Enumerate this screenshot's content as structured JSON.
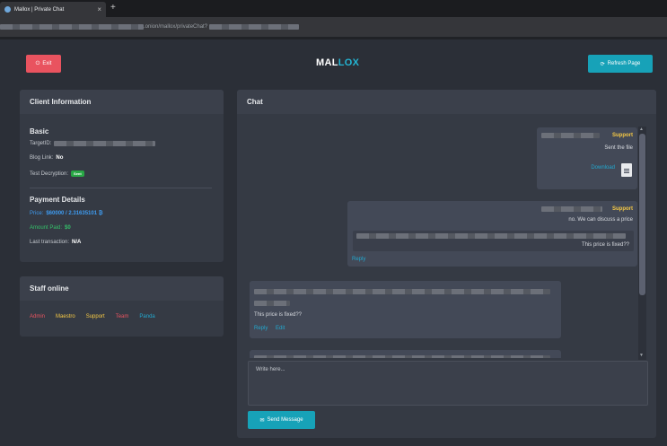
{
  "browser": {
    "tab_title": "Mallox | Private Chat",
    "tab_close": "×",
    "new_tab": "+",
    "url_visible": ".onion/mallox/privateChat?"
  },
  "header": {
    "exit_label": "Exit",
    "logo_part1": "MAL",
    "logo_part2": "LOX",
    "refresh_label": "Refresh Page"
  },
  "client_info": {
    "title": "Client Information",
    "basic_title": "Basic",
    "target_label": "TargetID:",
    "blog_label": "Blog Link:",
    "blog_value": "No",
    "test_label": "Test Decryption:",
    "test_badge": "Sent",
    "payment_title": "Payment Details",
    "price_label": "Price:",
    "price_value": "$60000 / 2.31635101 ₿",
    "paid_label": "Amount Paid:",
    "paid_value": "$0",
    "last_label": "Last transaction:",
    "last_value": "N/A"
  },
  "staff": {
    "title": "Staff online",
    "members": [
      {
        "name": "Admin",
        "color": "#e9535f"
      },
      {
        "name": "Maestro",
        "color": "#f6c945"
      },
      {
        "name": "Support",
        "color": "#f6c945"
      },
      {
        "name": "Team",
        "color": "#e9535f"
      },
      {
        "name": "Panda",
        "color": "#23a8cf"
      }
    ]
  },
  "chat": {
    "title": "Chat",
    "messages": [
      {
        "sender": "Support",
        "text": "Sent the file",
        "action": "Download"
      },
      {
        "sender": "Support",
        "text": "no. We can discuss a price",
        "quote": "This price is fixed??",
        "action": "Reply"
      },
      {
        "text": "This price is fixed??",
        "action1": "Reply",
        "action2": "Edit"
      }
    ],
    "input_placeholder": "Write here...",
    "send_label": "Send Message"
  },
  "colors": {
    "accent": "#17a2b8",
    "danger": "#e9535f",
    "support_name": "#f6c945"
  }
}
